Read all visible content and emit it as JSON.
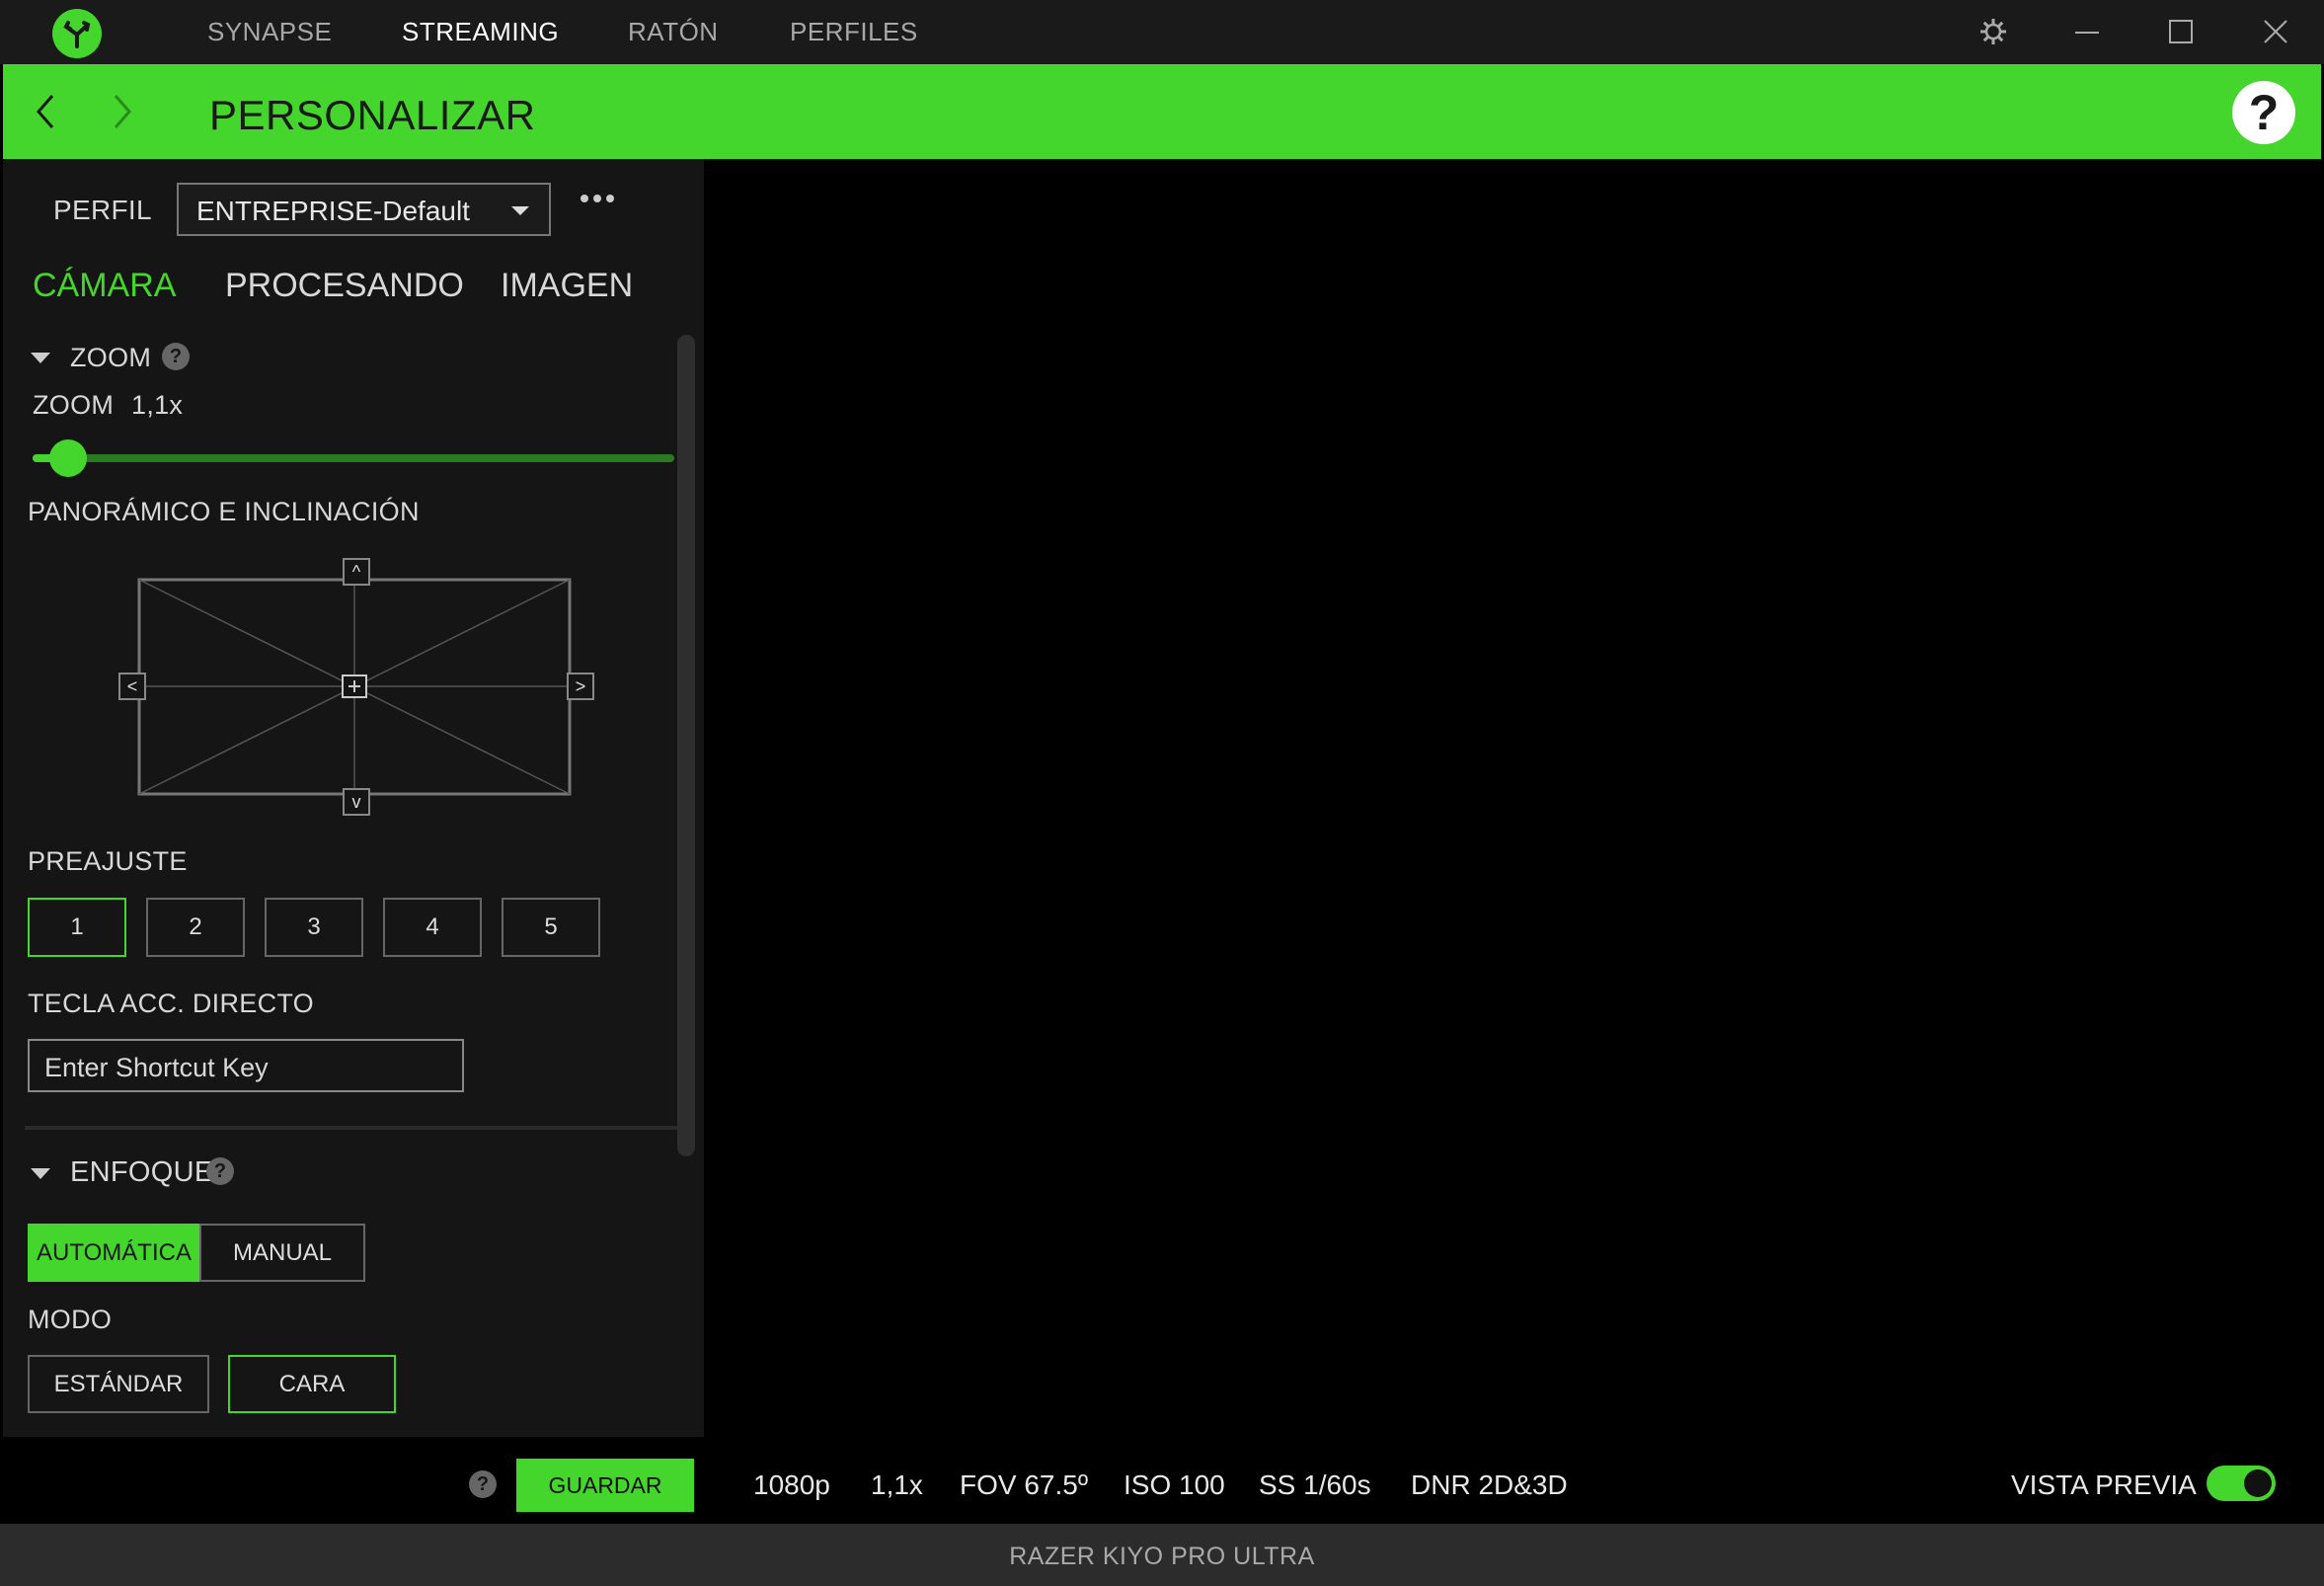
{
  "titlebar": {
    "nav": [
      "SYNAPSE",
      "STREAMING",
      "RATÓN",
      "PERFILES"
    ],
    "active_nav": "STREAMING"
  },
  "header": {
    "title": "PERSONALIZAR",
    "help": "?"
  },
  "profile": {
    "label": "PERFIL",
    "value": "ENTREPRISE-Default"
  },
  "tabs": [
    "CÁMARA",
    "PROCESANDO",
    "IMAGEN"
  ],
  "zoom": {
    "section": "ZOOM",
    "label": "ZOOM",
    "value": "1,1x",
    "slider_fraction": 0.04
  },
  "pan_tilt": {
    "label": "PANORÁMICO E INCLINACIÓN",
    "up": "^",
    "down": "v",
    "left": "<",
    "right": ">"
  },
  "preset": {
    "label": "PREAJUSTE",
    "buttons": [
      "1",
      "2",
      "3",
      "4",
      "5"
    ],
    "selected": "1"
  },
  "shortcut": {
    "label": "TECLA ACC. DIRECTO",
    "placeholder": "Enter Shortcut Key"
  },
  "focus": {
    "section": "ENFOQUE",
    "options": [
      "AUTOMÁTICA",
      "MANUAL"
    ],
    "selected": "AUTOMÁTICA"
  },
  "mode": {
    "label": "MODO",
    "options": [
      "ESTÁNDAR",
      "CARA"
    ],
    "selected": "CARA"
  },
  "bottombar": {
    "help": "?",
    "save_label": "GUARDAR",
    "stats": [
      "1080p",
      "1,1x",
      "FOV 67.5º",
      "ISO 100",
      "SS 1/60s",
      "DNR 2D&3D"
    ],
    "preview_label": "VISTA PREVIA",
    "preview_on": true
  },
  "footer": {
    "device": "RAZER KIYO PRO ULTRA"
  },
  "colors": {
    "accent": "#44d62c",
    "bg": "#151515",
    "titlebar": "#1a1a1a"
  }
}
